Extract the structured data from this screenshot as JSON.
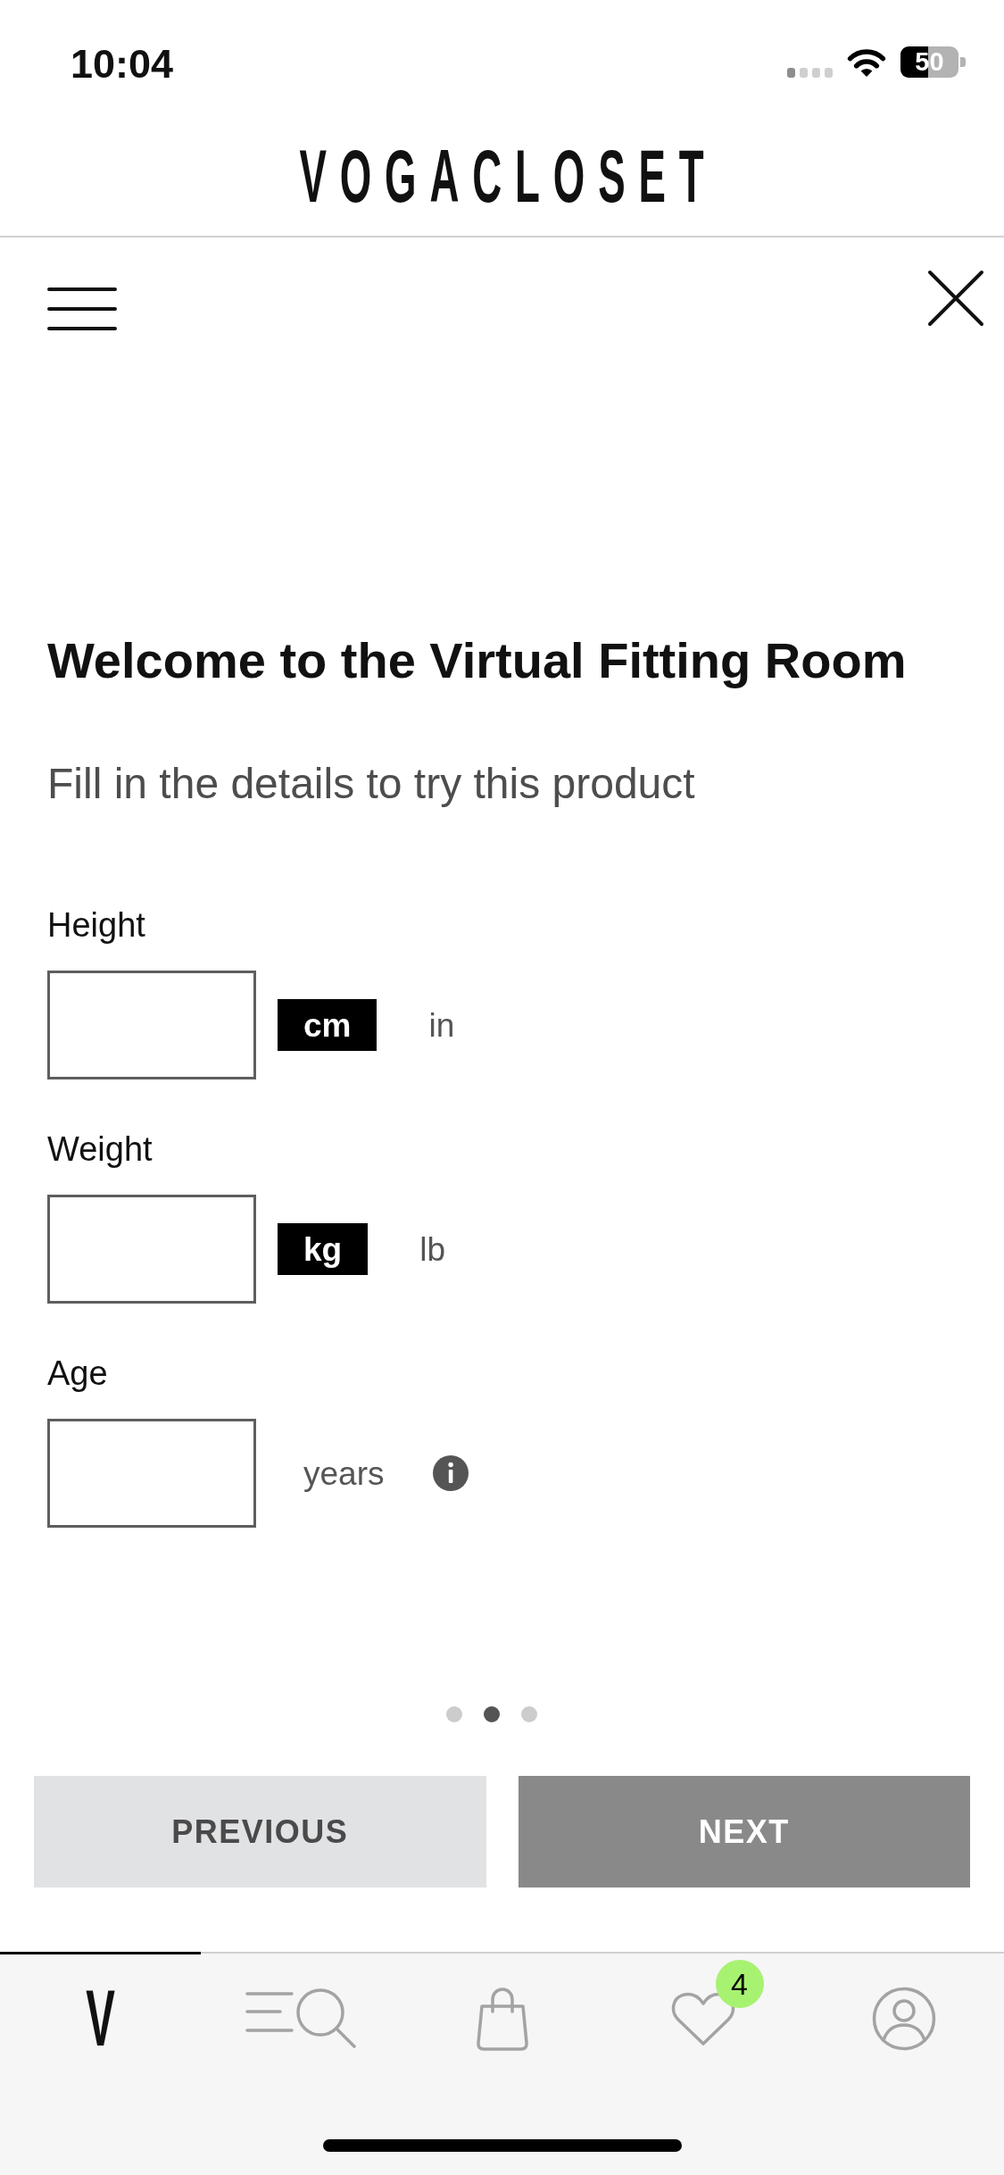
{
  "status_bar": {
    "time": "10:04",
    "battery": "50"
  },
  "header": {
    "logo": "VOGACLOSET"
  },
  "form": {
    "title": "Welcome to the Virtual Fitting Room",
    "subtitle": "Fill in the details to try this product",
    "fields": [
      {
        "kind": "units",
        "label": "Height",
        "units": [
          {
            "label": "cm",
            "selected": true
          },
          {
            "label": "in",
            "selected": false
          }
        ]
      },
      {
        "kind": "units",
        "label": "Weight",
        "units": [
          {
            "label": "kg",
            "selected": true
          },
          {
            "label": "lb",
            "selected": false
          }
        ]
      },
      {
        "kind": "suffix",
        "label": "Age",
        "suffix": "years",
        "info": true
      }
    ]
  },
  "pager": {
    "pages": [
      {
        "selected": false
      },
      {
        "selected": true
      },
      {
        "selected": false
      }
    ]
  },
  "buttons": [
    {
      "kind": "previous",
      "label": "PREVIOUS"
    },
    {
      "kind": "next",
      "label": "NEXT"
    }
  ],
  "tab_bar": {
    "tabs": [
      {
        "kind": "logo",
        "label": "V",
        "selected": true
      },
      {
        "kind": "search",
        "selected": false
      },
      {
        "kind": "bag",
        "selected": false
      },
      {
        "kind": "wishlist",
        "badge": "4",
        "selected": false
      },
      {
        "kind": "account",
        "selected": false
      }
    ]
  }
}
